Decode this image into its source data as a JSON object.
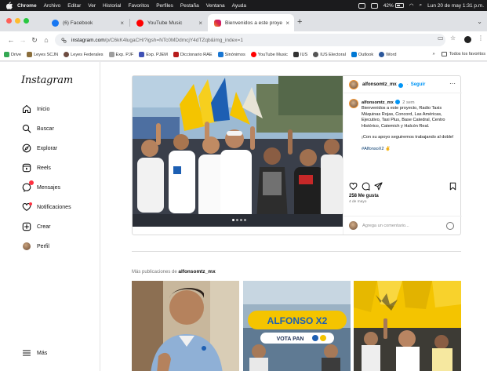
{
  "menubar": {
    "app": "Chrome",
    "items": [
      "Archivo",
      "Editar",
      "Ver",
      "Historial",
      "Favoritos",
      "Perfiles",
      "Pestaña",
      "Ventana",
      "Ayuda"
    ],
    "battery": "42%",
    "clock": "Lun 20 de may 1:31 p.m."
  },
  "tabs": [
    {
      "title": "(6) Facebook",
      "color": "#1877f2"
    },
    {
      "title": "YouTube Music",
      "color": "#ff0000"
    },
    {
      "title": "Bienvenidos a este proyecto",
      "color": "#e1306c"
    }
  ],
  "toolbar": {
    "url_host": "instagram.com",
    "url_path": "/p/C6kK4lugaCH/?igsh=NTc0MDdmcjY4dTZqb&img_index=1"
  },
  "bookmarks": {
    "items": [
      {
        "label": "Drive",
        "color": "#34a853"
      },
      {
        "label": "Leyes SCJN",
        "color": "#8a6d3b"
      },
      {
        "label": "Leyes Federales",
        "color": "#6d4c41"
      },
      {
        "label": "Exp. PJF",
        "color": "#9e9e9e"
      },
      {
        "label": "Exp. PJEM",
        "color": "#3f51b5"
      },
      {
        "label": "Diccionario RAE",
        "color": "#b71c1c"
      },
      {
        "label": "Sinónimos",
        "color": "#1976d2"
      },
      {
        "label": "YouTube Music",
        "color": "#ff0000"
      },
      {
        "label": "IUS",
        "color": "#333333"
      },
      {
        "label": "IUS Electoral",
        "color": "#555555"
      },
      {
        "label": "Outlook",
        "color": "#0078d4"
      },
      {
        "label": "Word",
        "color": "#2b579a"
      }
    ],
    "overflow": "»",
    "all_label": "Todos los favoritos"
  },
  "sidebar": {
    "logo": "Instagram",
    "items": [
      {
        "label": "Inicio",
        "icon": "home-icon"
      },
      {
        "label": "Buscar",
        "icon": "search-icon"
      },
      {
        "label": "Explorar",
        "icon": "compass-icon"
      },
      {
        "label": "Reels",
        "icon": "reels-icon"
      },
      {
        "label": "Mensajes",
        "icon": "messenger-icon"
      },
      {
        "label": "Notificaciones",
        "icon": "heart-icon"
      },
      {
        "label": "Crear",
        "icon": "plus-square-icon"
      },
      {
        "label": "Perfil",
        "icon": "avatar"
      }
    ],
    "more_label": "Más"
  },
  "post": {
    "username": "alfonsomtz_mx",
    "follow_label": "Seguir",
    "time": "2 sem",
    "caption": "Bienvenidos a este proyecto, Radio Taxis Máquinas Rojas, Concord, Las Américas, Ejecutivo, Taxi Plus, Base Catedral, Centro Histórico, Catemich y Halcón Real.",
    "caption2": "¡Con su apoyo seguiremos trabajando al doble!",
    "hashtag": "#AlfonsoX2 ✌️",
    "likes": "258 Me gusta",
    "date": "4 de mayo",
    "comment_placeholder": "Agrega un comentario...",
    "slides": 4,
    "active_slide": 1
  },
  "more": {
    "prefix": "Más publicaciones de ",
    "username": "alfonsomtz_mx",
    "thumb2_text1": "ALFONSO X2",
    "thumb2_text2": "VOTA PAN"
  },
  "colors": {
    "link_blue": "#0095f6",
    "pan_blue": "#1d5fb3",
    "prd_yellow": "#f4c400"
  }
}
